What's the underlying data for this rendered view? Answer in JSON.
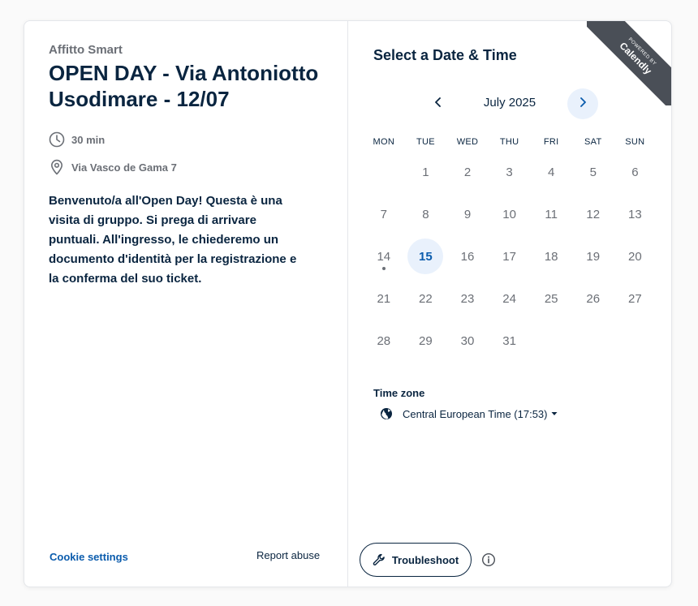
{
  "event": {
    "organizer": "Affitto Smart",
    "title": "OPEN DAY - Via Antoniotto Usodimare - 12/07",
    "duration": "30 min",
    "location": "Via Vasco de Gama 7",
    "description": "Benvenuto/a all'Open Day! Questa è una visita di gruppo. Si prega di arrivare puntuali. All'ingresso, le chiederemo un documento d'identità per la registrazione e la conferma del suo ticket."
  },
  "footer": {
    "cookie_settings": "Cookie settings",
    "report_abuse": "Report abuse"
  },
  "scheduler": {
    "title": "Select a Date & Time",
    "ribbon_small": "POWERED BY",
    "ribbon_big": "Calendly",
    "month": "July 2025",
    "weekdays": [
      "MON",
      "TUE",
      "WED",
      "THU",
      "FRI",
      "SAT",
      "SUN"
    ],
    "days": [
      "",
      "1",
      "2",
      "3",
      "4",
      "5",
      "6",
      "7",
      "8",
      "9",
      "10",
      "11",
      "12",
      "13",
      "14",
      "15",
      "16",
      "17",
      "18",
      "19",
      "20",
      "21",
      "22",
      "23",
      "24",
      "25",
      "26",
      "27",
      "28",
      "29",
      "30",
      "31"
    ],
    "selected_day": "15",
    "today_day": "14",
    "timezone_label": "Time zone",
    "timezone_value": "Central European Time (17:53)",
    "troubleshoot": "Troubleshoot"
  },
  "colors": {
    "primary_text": "#0a2540",
    "muted_text": "#6b6f76",
    "accent": "#0b5cad",
    "selected_bg": "#e9f1fc",
    "ribbon_bg": "#4a4f57"
  }
}
